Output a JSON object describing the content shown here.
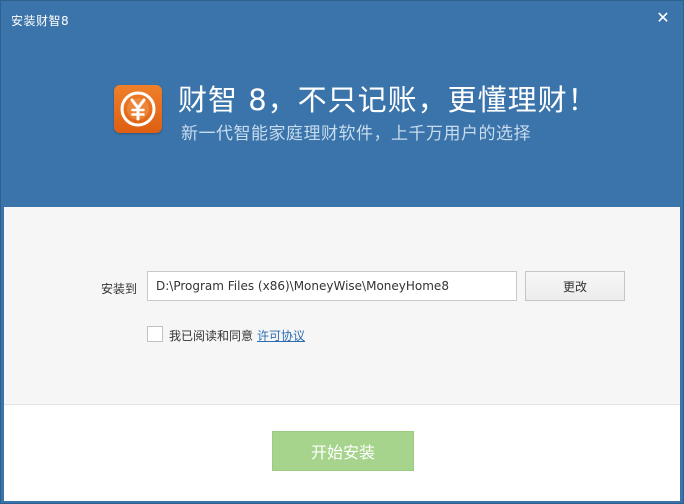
{
  "window": {
    "title": "安装财智8",
    "close_icon": "close-icon",
    "header_color": "#3b74aa"
  },
  "banner": {
    "logo_icon": "yen-coin-icon",
    "logo_color": "#e8701f",
    "headline": "财智 8，不只记账，更懂理财！",
    "subline": "新一代智能家庭理财软件，上千万用户的选择"
  },
  "install_path": {
    "label": "安装到",
    "value": "D:\\Program Files (x86)\\MoneyWise\\MoneyHome8",
    "change_label": "更改"
  },
  "agreement": {
    "checked": false,
    "text": "我已阅读和同意",
    "link_text": "许可协议"
  },
  "footer": {
    "install_label": "开始安装",
    "install_color": "#a6d48c"
  }
}
